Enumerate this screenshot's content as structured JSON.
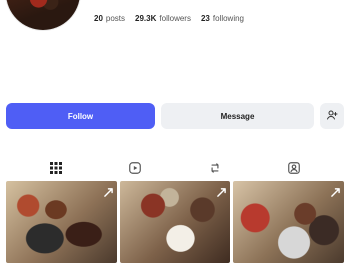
{
  "profile": {
    "stats": {
      "posts_count": "20",
      "posts_label": "posts",
      "followers_count": "29.3K",
      "followers_label": "followers",
      "following_count": "23",
      "following_label": "following"
    }
  },
  "actions": {
    "follow_label": "Follow",
    "message_label": "Message"
  },
  "colors": {
    "accent": "#4f5ef5",
    "secondary_button": "#eef0f3"
  },
  "icons": {
    "add_user": "add-user-icon",
    "grid": "grid-icon",
    "reels": "reels-icon",
    "reposts": "repost-icon",
    "tagged": "tagged-icon",
    "post_corner": "carousel-icon"
  }
}
